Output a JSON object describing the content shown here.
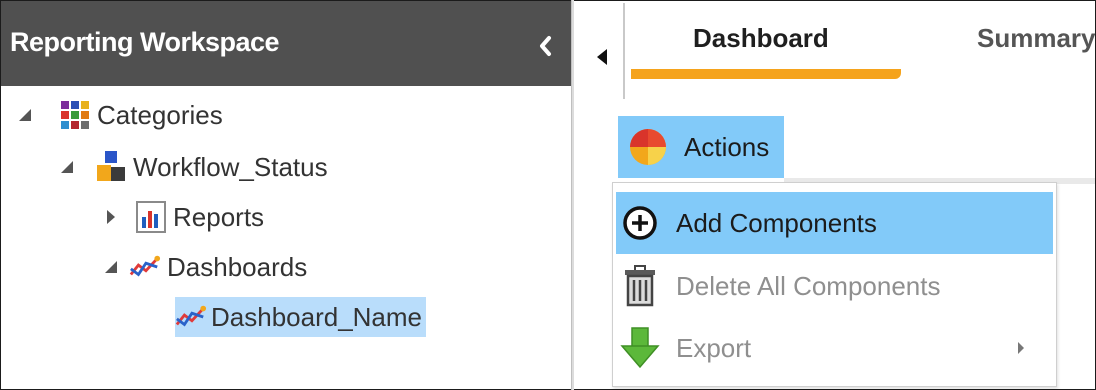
{
  "workspace": {
    "title": "Reporting Workspace"
  },
  "tree": {
    "nodes": [
      {
        "label": "Categories",
        "icon": "categories-grid-icon"
      },
      {
        "label": "Workflow_Status",
        "icon": "workflow-blocks-icon"
      },
      {
        "label": "Reports",
        "icon": "report-chart-icon"
      },
      {
        "label": "Dashboards",
        "icon": "dashboard-line-icon"
      },
      {
        "label": "Dashboard_Name",
        "icon": "dashboard-line-icon",
        "selected": true
      }
    ]
  },
  "tabs": [
    {
      "label": "Dashboard",
      "active": true
    },
    {
      "label": "Summary",
      "active": false
    }
  ],
  "actions": {
    "label": "Actions"
  },
  "menu": {
    "items": [
      {
        "label": "Add Components",
        "icon": "add-circle-icon",
        "state": "hover"
      },
      {
        "label": "Delete All Components",
        "icon": "trash-icon",
        "state": "disabled"
      },
      {
        "label": "Export",
        "icon": "export-down-arrow-icon",
        "state": "disabled",
        "submenu": true
      }
    ]
  },
  "colors": {
    "header_bg": "#505050",
    "highlight_blue": "#82caf9",
    "selection_blue": "#b9ddfb",
    "tab_accent": "#f5a31c"
  }
}
